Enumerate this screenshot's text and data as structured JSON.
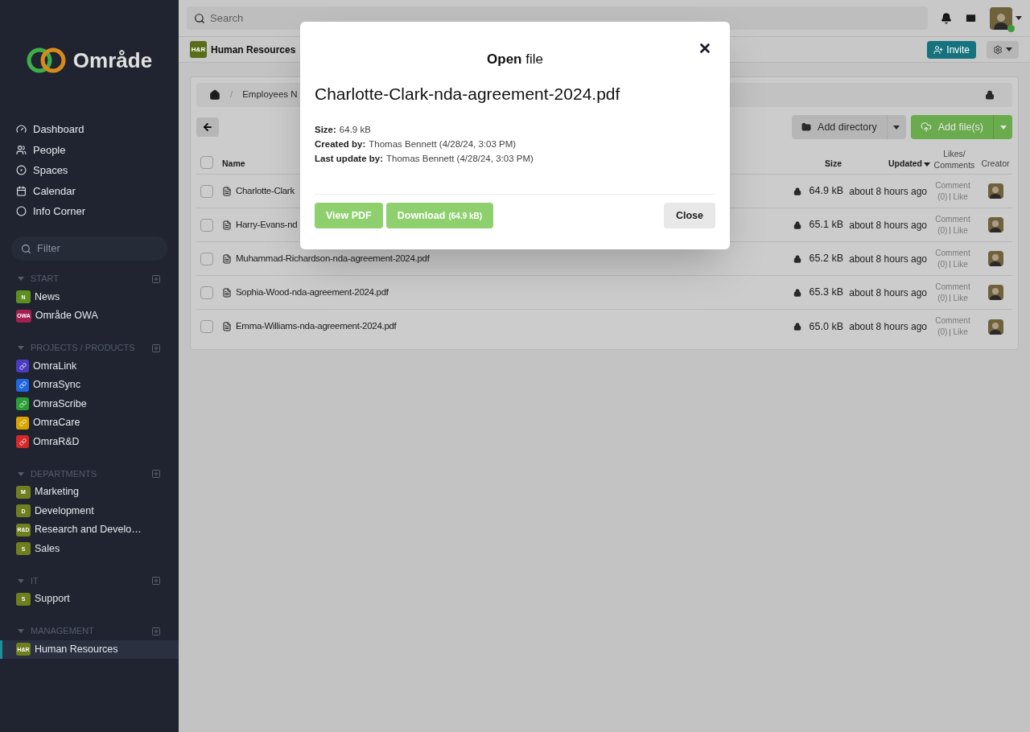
{
  "sidebar": {
    "logo": "Område",
    "nav": [
      {
        "kind": "dashboard",
        "label": "Dashboard"
      },
      {
        "kind": "people",
        "label": "People"
      },
      {
        "kind": "spaces",
        "label": "Spaces"
      },
      {
        "kind": "calendar",
        "label": "Calendar"
      },
      {
        "kind": "info",
        "label": "Info Corner"
      }
    ],
    "filter": {
      "placeholder": "Filter"
    },
    "sections": [
      {
        "title": "START",
        "items": [
          {
            "kind": "letter",
            "badge": "N",
            "color": "#5f8f22",
            "label": "News",
            "selected": false
          },
          {
            "kind": "letter",
            "badge": "OWA",
            "color": "#a3204f",
            "label": "Område OWA",
            "selected": false
          }
        ]
      },
      {
        "title": "PROJECTS / PRODUCTS",
        "items": [
          {
            "kind": "project",
            "color": "#4a3bc0",
            "label": "OmraLink",
            "selected": false
          },
          {
            "kind": "project",
            "color": "#1f66e0",
            "label": "OmraSync",
            "selected": false
          },
          {
            "kind": "project",
            "color": "#2a9e34",
            "label": "OmraScribe",
            "selected": false
          },
          {
            "kind": "project",
            "color": "#d9a400",
            "label": "OmraCare",
            "selected": false
          },
          {
            "kind": "project",
            "color": "#d42727",
            "label": "OmraR&D",
            "selected": false
          }
        ]
      },
      {
        "title": "DEPARTMENTS",
        "items": [
          {
            "kind": "letter",
            "badge": "M",
            "color": "#6f7f1f",
            "label": "Marketing",
            "selected": false
          },
          {
            "kind": "letter",
            "badge": "D",
            "color": "#6f7f1f",
            "label": "Development",
            "selected": false
          },
          {
            "kind": "letter",
            "badge": "R&D",
            "color": "#6f7f1f",
            "label": "Research and Develo…",
            "selected": false
          },
          {
            "kind": "letter",
            "badge": "S",
            "color": "#6f7f1f",
            "label": "Sales",
            "selected": false
          }
        ]
      },
      {
        "title": "IT",
        "items": [
          {
            "kind": "letter",
            "badge": "S",
            "color": "#6f7f1f",
            "label": "Support",
            "selected": false
          }
        ]
      },
      {
        "title": "MANAGEMENT",
        "items": [
          {
            "kind": "letter",
            "badge": "H&R",
            "color": "#6f7f1f",
            "label": "Human Resources",
            "selected": true
          }
        ]
      }
    ]
  },
  "topbar": {
    "search": {
      "placeholder": "Search"
    },
    "online": true
  },
  "space": {
    "badge": "H&R",
    "title": "Human Resources",
    "invite": "Invite"
  },
  "breadcrumb": {
    "separator": "/",
    "item": "Employees N"
  },
  "toolbar": {
    "add_directory": "Add directory",
    "add_files": "Add file(s)"
  },
  "table": {
    "select_all": {
      "checked": false
    },
    "columns": [
      {
        "label": "Name",
        "sorted": false
      },
      {
        "label": "Size",
        "sorted": false
      },
      {
        "label": "Updated",
        "sorted": true
      },
      {
        "label": "Likes/ Comments",
        "sorted": false
      },
      {
        "label": "Creator",
        "sorted": false
      }
    ],
    "rows": [
      {
        "checked": false,
        "name": "Charlotte-Clark",
        "locked": true,
        "size": "64.9 kB",
        "updated": "about 8 hours ago",
        "comment": "Comment",
        "count": "(0)",
        "like": "Like"
      },
      {
        "checked": false,
        "name": "Harry-Evans-nd",
        "locked": true,
        "size": "65.1 kB",
        "updated": "about 8 hours ago",
        "comment": "Comment",
        "count": "(0)",
        "like": "Like"
      },
      {
        "checked": false,
        "name": "Muhammad-Richardson-nda-agreement-2024.pdf",
        "locked": true,
        "size": "65.2 kB",
        "updated": "about 8 hours ago",
        "comment": "Comment",
        "count": "(0)",
        "like": "Like"
      },
      {
        "checked": false,
        "name": "Sophia-Wood-nda-agreement-2024.pdf",
        "locked": true,
        "size": "65.3 kB",
        "updated": "about 8 hours ago",
        "comment": "Comment",
        "count": "(0)",
        "like": "Like"
      },
      {
        "checked": false,
        "name": "Emma-Williams-nda-agreement-2024.pdf",
        "locked": true,
        "size": "65.0 kB",
        "updated": "about 8 hours ago",
        "comment": "Comment",
        "count": "(0)",
        "like": "Like"
      }
    ]
  },
  "modal": {
    "title": "**Open** file",
    "filename": "Charlotte-Clark-nda-agreement-2024.pdf",
    "details": [
      {
        "label": "Size:",
        "value": "64.9 kB"
      },
      {
        "label": "Created by:",
        "value": "Thomas Bennett (4/28/24, 3:03 PM)"
      },
      {
        "label": "Last update by:",
        "value": "Thomas Bennett (4/28/24, 3:03 PM)"
      }
    ],
    "view": "View PDF",
    "download": "Download",
    "download_size": "(64.9 kB)",
    "close": "Close"
  }
}
